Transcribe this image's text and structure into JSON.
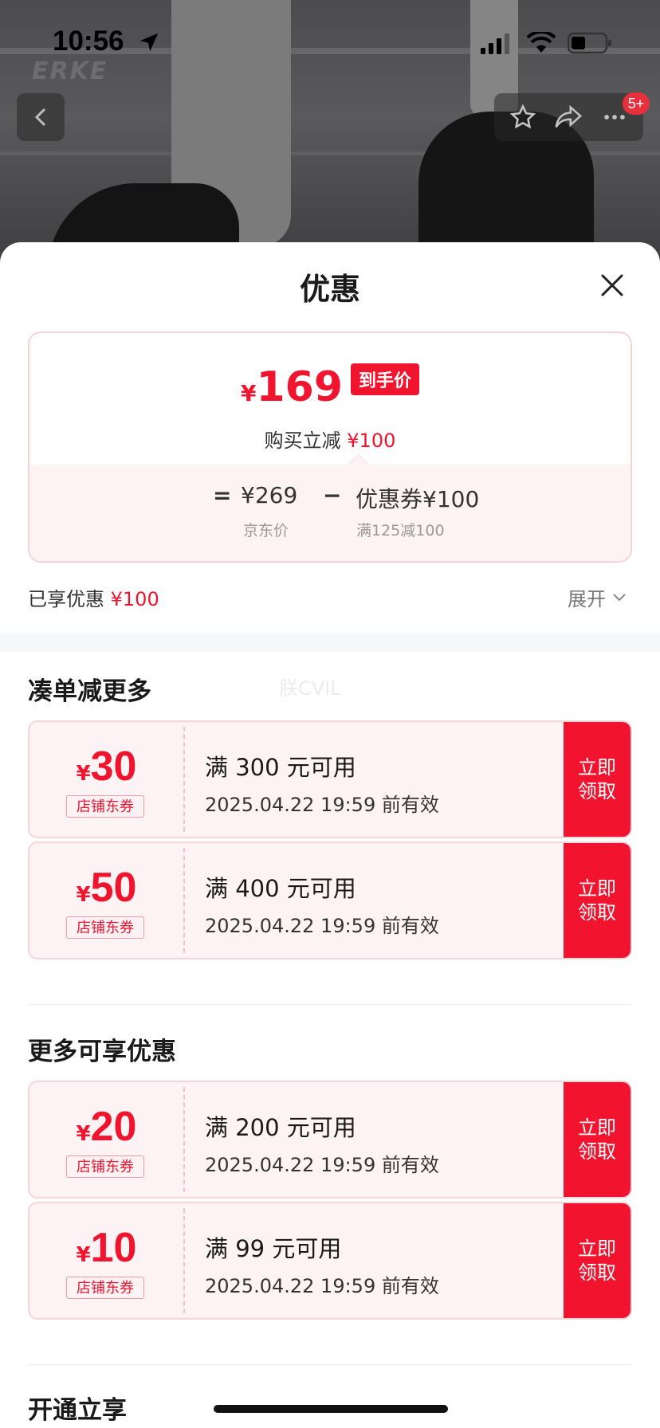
{
  "status_bar": {
    "time": "10:56"
  },
  "header": {
    "logo": "ERKE",
    "cart_badge": "5+"
  },
  "sheet": {
    "title": "优惠",
    "price": {
      "currency": "¥",
      "final": "169",
      "final_tag": "到手价",
      "instant_label": "购买立减",
      "instant_amount": "¥100",
      "eq_sign": "=",
      "jd_price": "¥269",
      "minus": "−",
      "coupon_label": "优惠券",
      "coupon_amount": "¥100",
      "jd_price_label": "京东价",
      "coupon_rule": "满125减100"
    },
    "enjoyed_label": "已享优惠",
    "enjoyed_amount": "¥100",
    "expand_label": "展开",
    "section1_title": "凑单减更多",
    "watermark": "朕CVIL",
    "section2_title": "更多可享优惠",
    "section3_title": "开通立享"
  },
  "coupons_more": [
    {
      "currency": "¥",
      "amount": "30",
      "kind": "店铺东券",
      "condition": "满 300 元可用",
      "valid": "2025.04.22 19:59 前有效",
      "claim": "立即领取"
    },
    {
      "currency": "¥",
      "amount": "50",
      "kind": "店铺东券",
      "condition": "满 400 元可用",
      "valid": "2025.04.22 19:59 前有效",
      "claim": "立即领取"
    }
  ],
  "coupons_extra": [
    {
      "currency": "¥",
      "amount": "20",
      "kind": "店铺东券",
      "condition": "满 200 元可用",
      "valid": "2025.04.22 19:59 前有效",
      "claim": "立即领取"
    },
    {
      "currency": "¥",
      "amount": "10",
      "kind": "店铺东券",
      "condition": "满 99 元可用",
      "valid": "2025.04.22 19:59 前有效",
      "claim": "立即领取"
    }
  ],
  "colors": {
    "accent": "#f0142f",
    "coupon_bg": "#fdf3f4",
    "coupon_border": "#f6d5da"
  }
}
